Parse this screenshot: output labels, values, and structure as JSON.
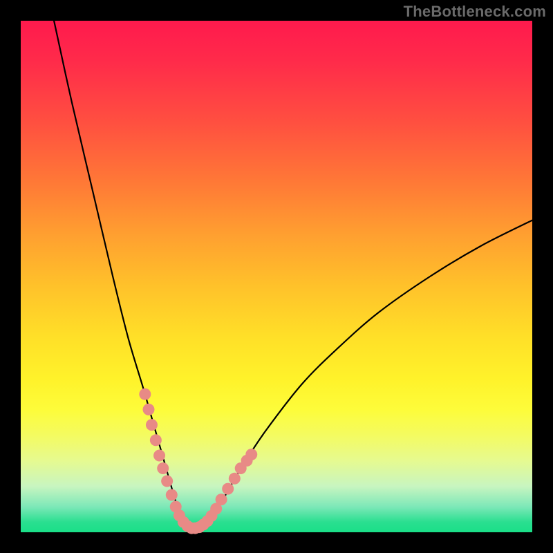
{
  "watermark": "TheBottleneck.com",
  "colors": {
    "background": "#000000",
    "gradient_top": "#ff1a4d",
    "gradient_mid_orange": "#ffa030",
    "gradient_mid_yellow": "#fff22a",
    "gradient_bottom": "#1adf88",
    "marker": "#e88a86",
    "curve": "#000000"
  },
  "chart_data": {
    "type": "line",
    "title": "",
    "xlabel": "",
    "ylabel": "",
    "xlim": [
      0,
      100
    ],
    "ylim": [
      0,
      100
    ],
    "grid": false,
    "legend": false,
    "description": "Bottleneck V-curve: percentage bottleneck vs. component balance. Minimum near x≈33 where bottleneck ≈ 0%. Left branch descends steeply from ~100% at x≈6.5 to the minimum; right branch rises with decreasing slope toward ~61% at x=100.",
    "series": [
      {
        "name": "bottleneck-curve",
        "x": [
          6.5,
          10,
          14,
          18,
          21,
          24,
          26,
          28,
          30,
          31,
          32,
          33,
          34,
          35,
          36,
          37,
          38.5,
          41,
          44,
          48,
          55,
          62,
          70,
          80,
          90,
          100
        ],
        "y": [
          100,
          84,
          67,
          50,
          38,
          28,
          21,
          14,
          7,
          4,
          2,
          0.8,
          0.5,
          0.7,
          1.2,
          2.2,
          4.5,
          9,
          14,
          20,
          29,
          36,
          43,
          50,
          56,
          61
        ]
      }
    ],
    "highlighted_points": {
      "name": "near-minimum-cluster",
      "x": [
        24.3,
        25.0,
        25.6,
        26.4,
        27.1,
        27.8,
        28.6,
        29.5,
        30.3,
        31.0,
        31.8,
        32.6,
        33.4,
        34.1,
        34.9,
        35.7,
        36.5,
        37.3,
        38.2,
        39.2,
        40.5,
        41.8,
        43.0,
        44.2,
        45.1
      ],
      "y": [
        27.0,
        24.0,
        21.0,
        18.0,
        15.0,
        12.5,
        10.0,
        7.3,
        5.0,
        3.3,
        2.0,
        1.2,
        0.8,
        0.8,
        1.0,
        1.5,
        2.2,
        3.2,
        4.6,
        6.4,
        8.5,
        10.5,
        12.5,
        14.0,
        15.2
      ]
    }
  }
}
